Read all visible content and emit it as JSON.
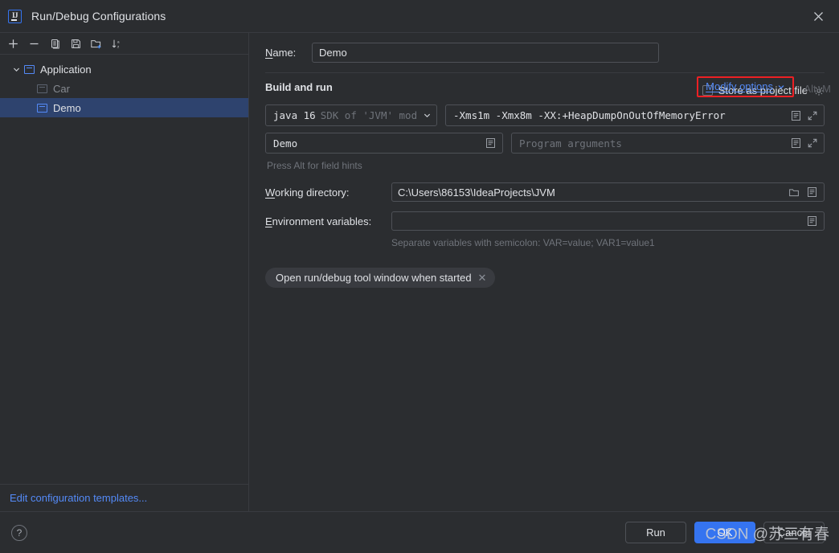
{
  "window": {
    "title": "Run/Debug Configurations",
    "app_icon": "intellij-idea-icon",
    "close_icon": "close-icon"
  },
  "left_panel": {
    "toolbar": [
      {
        "name": "add-configuration-button",
        "icon": "plus-icon",
        "tooltip": "Add New Configuration"
      },
      {
        "name": "remove-configuration-button",
        "icon": "minus-icon",
        "tooltip": "Remove Configuration"
      },
      {
        "name": "copy-configuration-button",
        "icon": "copy-icon",
        "tooltip": "Copy Configuration"
      },
      {
        "name": "save-configuration-button",
        "icon": "save-icon",
        "tooltip": "Save Configuration"
      },
      {
        "name": "new-folder-button",
        "icon": "new-folder-icon",
        "tooltip": "Create New Folder"
      },
      {
        "name": "sort-button",
        "icon": "sort-alphabetically-icon",
        "tooltip": "Sort Configurations"
      }
    ],
    "tree": [
      {
        "label": "Application",
        "type": "group",
        "expanded": true,
        "selected": false,
        "dimmed": false
      },
      {
        "label": "Car",
        "type": "child",
        "selected": false,
        "dimmed": true
      },
      {
        "label": "Demo",
        "type": "child",
        "selected": true,
        "dimmed": false
      }
    ],
    "footer_link": "Edit configuration templates..."
  },
  "form": {
    "name_label": "Name:",
    "name_label_mnemonic": "N",
    "name_value": "Demo",
    "store_as_project_file": {
      "label": "Store as project file",
      "mnemonic": "S",
      "checked": false,
      "gear_icon": "gear-icon"
    },
    "section_title": "Build and run",
    "modify_options": {
      "label": "Modify options",
      "mnemonic": "M",
      "chevron": "chevron-down-icon",
      "shortcut": "Alt+M",
      "highlight_color": "#ec2024"
    },
    "sdk": {
      "main": "java 16",
      "sub": "SDK of 'JVM' mod",
      "chevron": "chevron-down-icon"
    },
    "vm_options": {
      "value": "-Xms1m -Xmx8m -XX:+HeapDumpOnOutOfMemoryError",
      "expand_icon": "expand-icon",
      "list_icon": "insert-macro-icon"
    },
    "main_class": {
      "value": "Demo",
      "list_icon": "insert-macro-icon"
    },
    "program_arguments": {
      "placeholder": "Program arguments",
      "value": "",
      "expand_icon": "expand-icon",
      "list_icon": "insert-macro-icon"
    },
    "field_hint": "Press Alt for field hints",
    "working_directory": {
      "label": "Working directory:",
      "mnemonic": "W",
      "value": "C:\\Users\\86153\\IdeaProjects\\JVM",
      "browse_icon": "folder-icon",
      "list_icon": "insert-macro-icon"
    },
    "environment_variables": {
      "label": "Environment variables:",
      "mnemonic": "E",
      "value": "",
      "list_icon": "insert-macro-icon"
    },
    "env_hint": "Separate variables with semicolon: VAR=value; VAR1=value1",
    "chip": {
      "label": "Open run/debug tool window when started",
      "remove_icon": "close-small-icon"
    }
  },
  "footer": {
    "help_label": "?",
    "buttons": [
      {
        "name": "run-button",
        "label": "Run",
        "primary": false
      },
      {
        "name": "ok-button",
        "label": "OK",
        "primary": true
      },
      {
        "name": "cancel-button",
        "label": "Cancel",
        "primary": false
      }
    ],
    "watermark": "CSDN @苏三有春"
  },
  "colors": {
    "background": "#2b2d30",
    "border": "#393b40",
    "field_border": "#4e5157",
    "text": "#dfe1e5",
    "muted_text": "#6f737a",
    "accent_blue": "#3574f0",
    "link_blue": "#548af7",
    "selection": "#2e436e",
    "annotation_red": "#ec2024"
  }
}
